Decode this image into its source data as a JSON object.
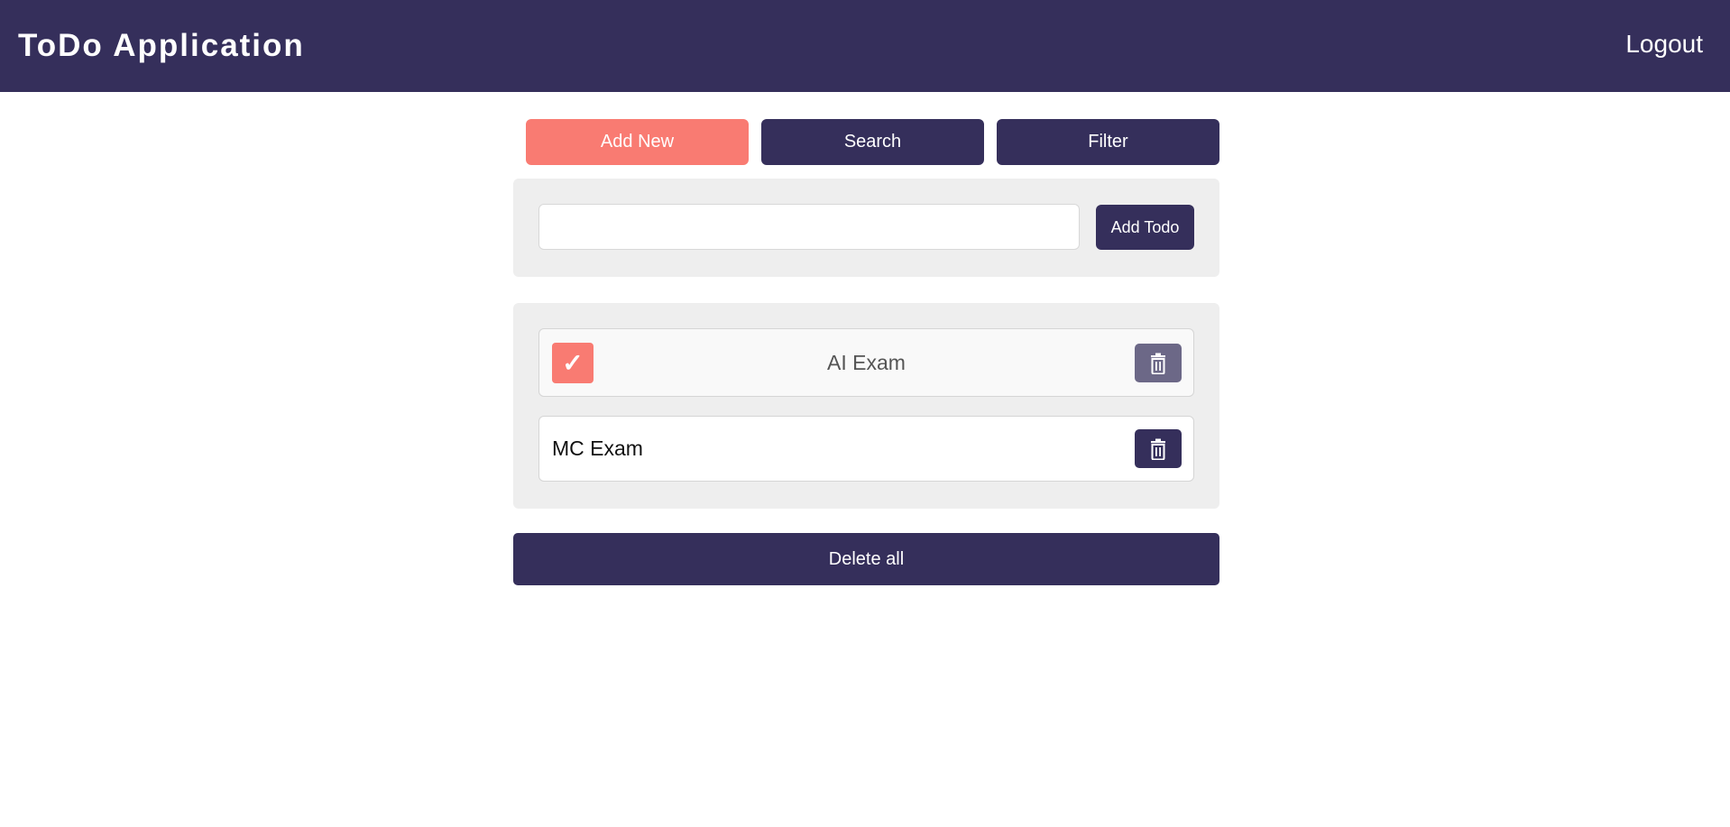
{
  "header": {
    "title": "ToDo Application",
    "logout_label": "Logout"
  },
  "tabs": [
    {
      "label": "Add New",
      "active": true
    },
    {
      "label": "Search",
      "active": false
    },
    {
      "label": "Filter",
      "active": false
    }
  ],
  "add_form": {
    "input_value": "",
    "input_placeholder": "",
    "button_label": "Add Todo"
  },
  "todos": [
    {
      "text": "AI Exam",
      "completed": true,
      "check_glyph": "✓",
      "delete_icon": "trash-icon"
    },
    {
      "text": "MC Exam",
      "completed": false,
      "delete_icon": "trash-icon"
    }
  ],
  "delete_all_label": "Delete all",
  "colors": {
    "primary": "#352f5b",
    "accent": "#f97b72",
    "panel_bg": "#eeeeee",
    "disabled_delete": "#6c6887"
  }
}
